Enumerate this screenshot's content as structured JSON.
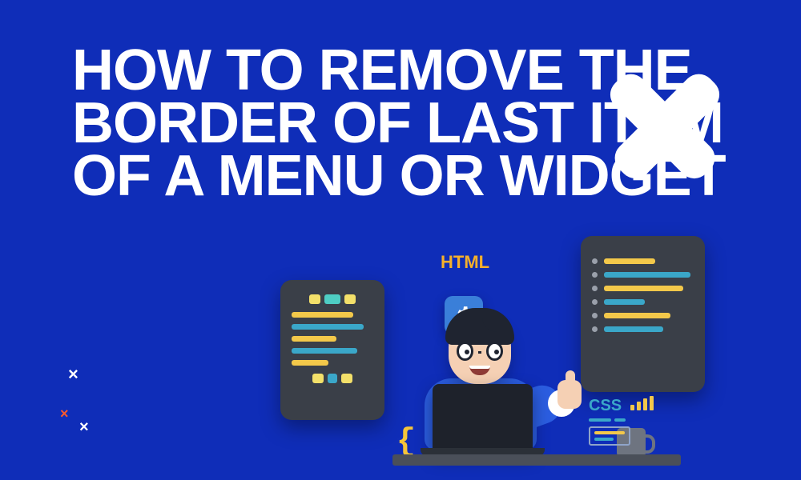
{
  "heading": "HOW TO REMOVE THE BORDER OF LAST ITEM OF A MENU OR WIDGET",
  "labels": {
    "html": "HTML",
    "css": "CSS",
    "braces": "{ }"
  },
  "decor": {
    "x1": "×",
    "x2": "×",
    "x3": "×"
  },
  "colors": {
    "background": "#0f2db8",
    "accent_yellow": "#f3c84a",
    "accent_teal": "#3aa7c9",
    "accent_orange": "#ff5a2b"
  }
}
